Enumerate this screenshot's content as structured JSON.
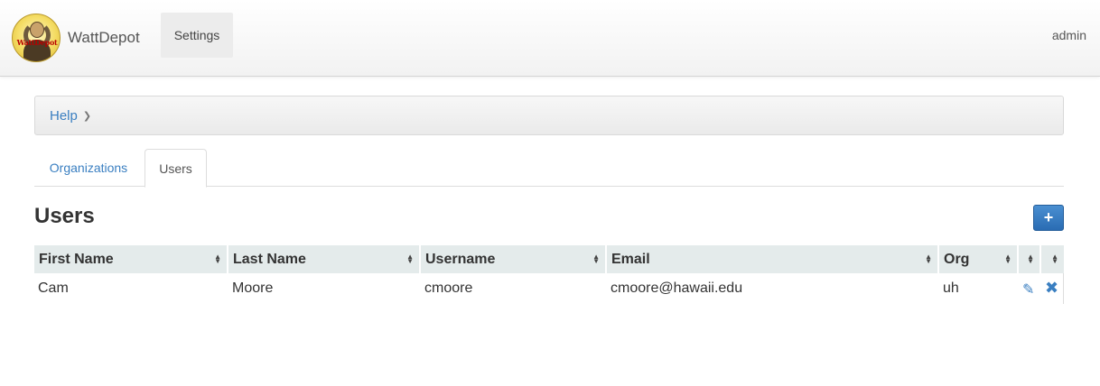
{
  "navbar": {
    "logo_text": "WattDepot",
    "brand": "WattDepot",
    "settings": "Settings",
    "user": "admin"
  },
  "breadcrumb": {
    "items": [
      "Help"
    ],
    "separator_icon": "chevron-right-icon"
  },
  "tabs": [
    {
      "label": "Organizations",
      "active": false
    },
    {
      "label": "Users",
      "active": true
    }
  ],
  "page": {
    "title": "Users",
    "add_icon": "plus-icon"
  },
  "table": {
    "columns": [
      "First Name",
      "Last Name",
      "Username",
      "Email",
      "Org",
      "",
      ""
    ],
    "rows": [
      {
        "first_name": "Cam",
        "last_name": "Moore",
        "username": "cmoore",
        "email": "cmoore@hawaii.edu",
        "org": "uh"
      }
    ],
    "row_actions": [
      "pencil-icon",
      "close-icon"
    ],
    "accent_color": "#3a7fc1",
    "header_bg": "#e4ebeb"
  }
}
